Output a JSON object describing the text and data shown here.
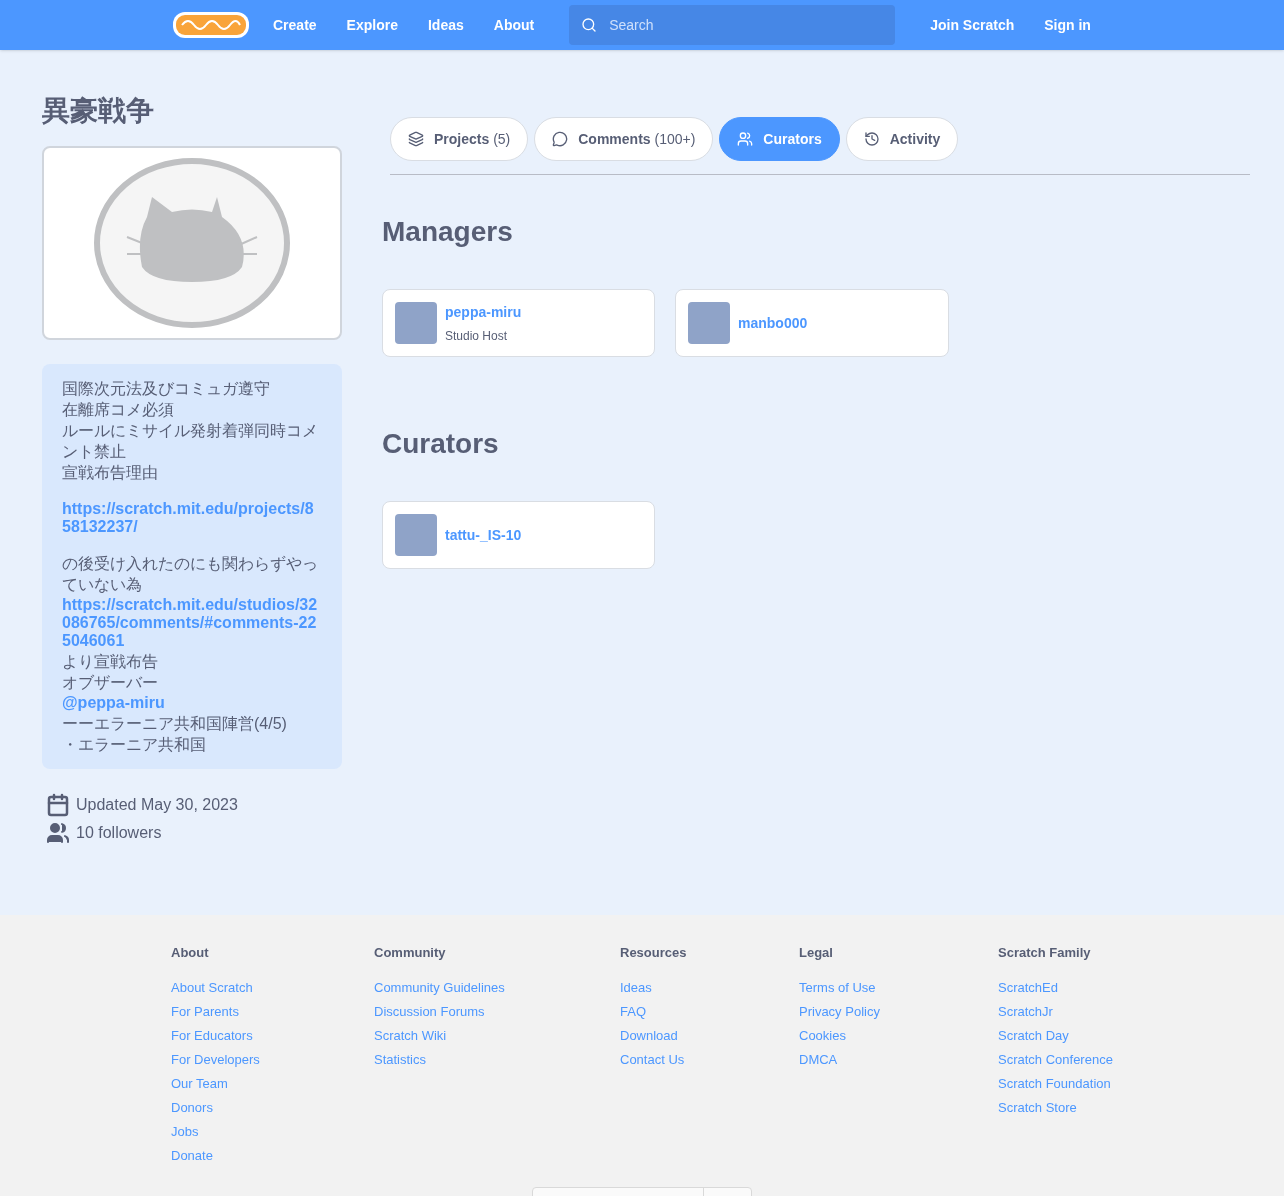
{
  "nav": {
    "links": [
      "Create",
      "Explore",
      "Ideas",
      "About"
    ],
    "search": {
      "placeholder": "Search"
    },
    "right": [
      "Join Scratch",
      "Sign in"
    ]
  },
  "studio": {
    "title": "異豪戦争",
    "description": [
      {
        "kind": "text",
        "text": "国際次元法及びコミュガ遵守"
      },
      {
        "kind": "text",
        "text": "在離席コメ必須"
      },
      {
        "kind": "text",
        "text": "ルールにミサイル発射着弾同時コメント禁止"
      },
      {
        "kind": "text",
        "text": "宣戦布告理由"
      },
      {
        "kind": "blank"
      },
      {
        "kind": "link",
        "text": "https://scratch.mit.edu/projects/858132237/"
      },
      {
        "kind": "blank"
      },
      {
        "kind": "text",
        "text": "の後受け入れたのにも関わらずやっていない為"
      },
      {
        "kind": "link",
        "text": "https://scratch.mit.edu/studios/32086765/comments/#comments-225046061"
      },
      {
        "kind": "text",
        "text": "より宣戦布告"
      },
      {
        "kind": "text",
        "text": "オブザーバー"
      },
      {
        "kind": "link",
        "text": "@peppa-miru"
      },
      {
        "kind": "text",
        "text": "ーーエラーニア共和国陣営(4/5)"
      },
      {
        "kind": "text",
        "text": "・エラーニア共和国"
      }
    ],
    "updated": "Updated May 30, 2023",
    "followers": "10 followers"
  },
  "tabs": [
    {
      "label": "Projects",
      "count": "(5)",
      "selected": false
    },
    {
      "label": "Comments",
      "count": "(100+)",
      "selected": false
    },
    {
      "label": "Curators",
      "selected": true
    },
    {
      "label": "Activity",
      "selected": false
    }
  ],
  "sections": [
    {
      "title": "Managers",
      "members": [
        {
          "name": "peppa-miru",
          "role": "Studio Host"
        },
        {
          "name": "manbo000"
        }
      ]
    },
    {
      "title": "Curators",
      "members": [
        {
          "name": "tattu-_IS-10"
        }
      ]
    }
  ],
  "footer": {
    "columns": [
      {
        "heading": "About",
        "links": [
          "About Scratch",
          "For Parents",
          "For Educators",
          "For Developers",
          "Our Team",
          "Donors",
          "Jobs",
          "Donate"
        ]
      },
      {
        "heading": "Community",
        "links": [
          "Community Guidelines",
          "Discussion Forums",
          "Scratch Wiki",
          "Statistics"
        ]
      },
      {
        "heading": "Resources",
        "links": [
          "Ideas",
          "FAQ",
          "Download",
          "Contact Us"
        ]
      },
      {
        "heading": "Legal",
        "links": [
          "Terms of Use",
          "Privacy Policy",
          "Cookies",
          "DMCA"
        ]
      },
      {
        "heading": "Scratch Family",
        "links": [
          "ScratchEd",
          "ScratchJr",
          "Scratch Day",
          "Scratch Conference",
          "Scratch Foundation",
          "Scratch Store"
        ]
      }
    ]
  }
}
